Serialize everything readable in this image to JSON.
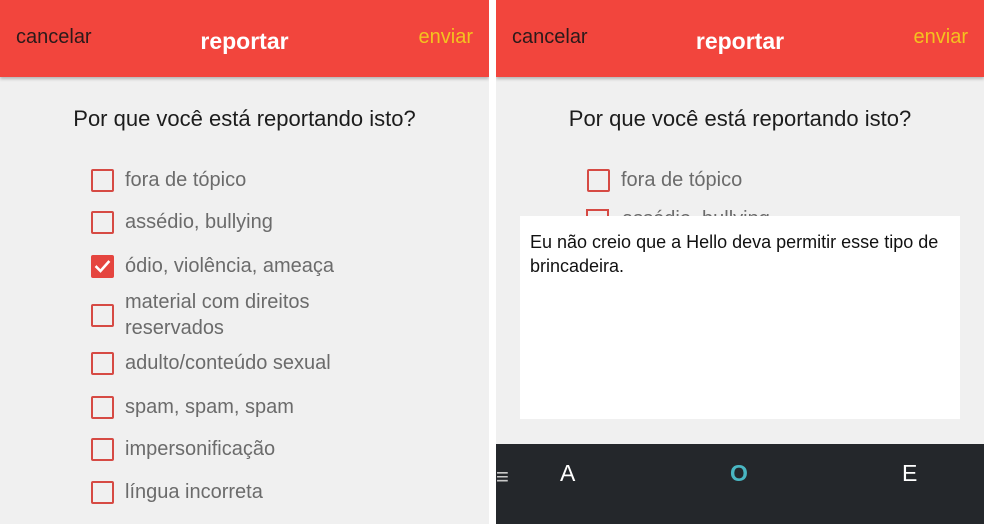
{
  "header": {
    "cancel": "cancelar",
    "title": "reportar",
    "send": "enviar"
  },
  "question": "Por que você está reportando isto?",
  "options": [
    {
      "label": "fora de tópico",
      "checked": false
    },
    {
      "label": "assédio, bullying",
      "checked": false
    },
    {
      "label": "ódio, violência, ameaça",
      "checked": true
    },
    {
      "label": "material com direitos reservados",
      "checked": false
    },
    {
      "label": "adulto/conteúdo sexual",
      "checked": false
    },
    {
      "label": "spam, spam, spam",
      "checked": false
    },
    {
      "label": "impersonificação",
      "checked": false
    },
    {
      "label": "língua incorreta",
      "checked": false
    }
  ],
  "report_text": "Eu não creio que a Hello deva permitir esse tipo de brincadeira.",
  "keyboard": {
    "suggestions": [
      "A",
      "O",
      "E"
    ],
    "menu_icon": "menu-icon"
  },
  "colors": {
    "header": "#f2453d",
    "send": "#f4c21f",
    "checkbox": "#e5453f",
    "keyboard": "#24272b",
    "suggestion_highlight": "#49b6c2"
  }
}
